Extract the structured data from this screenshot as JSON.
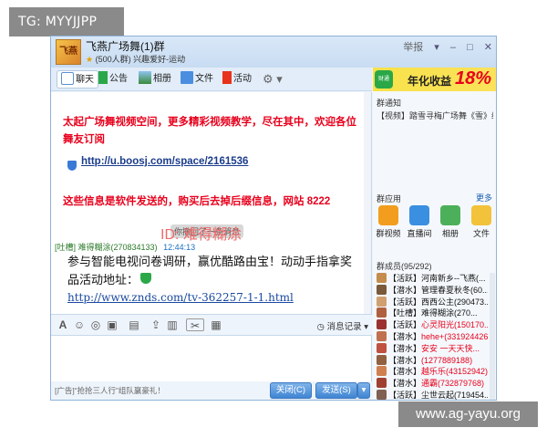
{
  "overlay": {
    "tg_label": "TG: MYYJJPP",
    "site_watermark": "www.ag-yayu.org",
    "id_watermark": "ID:  难得糊涂"
  },
  "window": {
    "group_name": "飞燕广场舞(1)群",
    "group_sub": "(500人群) 兴趣爱好-运动",
    "group_logo_text": "飞燕",
    "report_label": "举报",
    "controls": [
      "▾",
      "–",
      "□",
      "✕"
    ]
  },
  "toolbar": {
    "items": [
      {
        "label": "聊天",
        "icon": "chat-icon",
        "color": "#5b8fd0"
      },
      {
        "label": "公告",
        "icon": "flag-icon",
        "color": "#2aa848"
      },
      {
        "label": "相册",
        "icon": "photo-icon",
        "color": "#5b8fd0"
      },
      {
        "label": "文件",
        "icon": "folder-icon",
        "color": "#4b8ee0"
      },
      {
        "label": "活动",
        "icon": "activity-flag-icon",
        "color": "#e8321c"
      }
    ],
    "more_icon": "gear-icon"
  },
  "chat": {
    "promo_line1": "太起广场舞视频空间，更多精彩视频教学，尽在其中，欢迎各位",
    "promo_line2": "舞友订阅",
    "promo_link": "http://u.boosj.com/space/2161536",
    "notice_text": "这些信息是软件发送的，购买后去掉后缀信息，网站 8222",
    "recall_tip": "你撤回了一条消息",
    "sender_name": "[吐槽] 难得糊涂(270834133)",
    "sender_time": "12:44:13",
    "message_line1": "参与智能电视问卷调研，赢优酷路由宝！动动手指拿奖",
    "message_line2": "品活动地址：",
    "message_link": "http://www.znds.com/tv-362257-1-1.html"
  },
  "input_toolbar": {
    "icons": [
      "font-icon",
      "emoji-icon",
      "vibrate-icon",
      "gift-icon",
      "image-icon",
      "shake-icon",
      "mic-icon",
      "screenshot-icon"
    ],
    "history_label": "消息记录"
  },
  "bottom": {
    "ad_text": "[广告]“抢抢三人行”组队赢豪礼！",
    "close_label": "关闭(C)",
    "send_label": "发送(S)"
  },
  "right": {
    "ad_words": "年化收益",
    "ad_percent": "18%",
    "ad_logo": "财通",
    "notice_title": "群通知",
    "notice_item": "【视频】踏雪寻梅广场舞《雪》编...",
    "apps_title": "群应用",
    "apps_more": "更多",
    "apps": [
      {
        "label": "群视频",
        "color": "#f29d1e"
      },
      {
        "label": "直播间",
        "color": "#3a8fe0"
      },
      {
        "label": "相册",
        "color": "#4cb05a"
      },
      {
        "label": "文件",
        "color": "#f2c23a"
      }
    ],
    "members_title": "群成员(95/292)",
    "members": [
      {
        "tag": "【活跃】",
        "name": "河南新乡--飞燕(...",
        "color": "#111",
        "av": "#c58c4e"
      },
      {
        "tag": "【潜水】",
        "name": "管理春夏秋冬(60...",
        "color": "#111",
        "av": "#7a5a3a"
      },
      {
        "tag": "【活跃】",
        "name": "西西公主(290473...",
        "color": "#111",
        "av": "#d0a070"
      },
      {
        "tag": "【吐槽】",
        "name": "难得糊涂(270...",
        "color": "#111",
        "av": "#b06040"
      },
      {
        "tag": "【活跃】",
        "name": "心灵阳光(150170...",
        "color": "#e8001c",
        "av": "#9a3030"
      },
      {
        "tag": "【潜水】",
        "name": "hehe+(331924426)",
        "color": "#e8001c",
        "av": "#c07050"
      },
      {
        "tag": "【潜水】",
        "name": "安安  一天天快...",
        "color": "#e8001c",
        "av": "#c05040"
      },
      {
        "tag": "【潜水】",
        "name": "(1277889188)",
        "color": "#e8001c",
        "av": "#906040"
      },
      {
        "tag": "【潜水】",
        "name": "越乐乐(43152942)",
        "color": "#e8001c",
        "av": "#d08050"
      },
      {
        "tag": "【潜水】",
        "name": "通霸(732879768)",
        "color": "#e8001c",
        "av": "#a04030"
      },
      {
        "tag": "【活跃】",
        "name": "尘世云起(719454...",
        "color": "#111",
        "av": "#806050"
      }
    ]
  }
}
